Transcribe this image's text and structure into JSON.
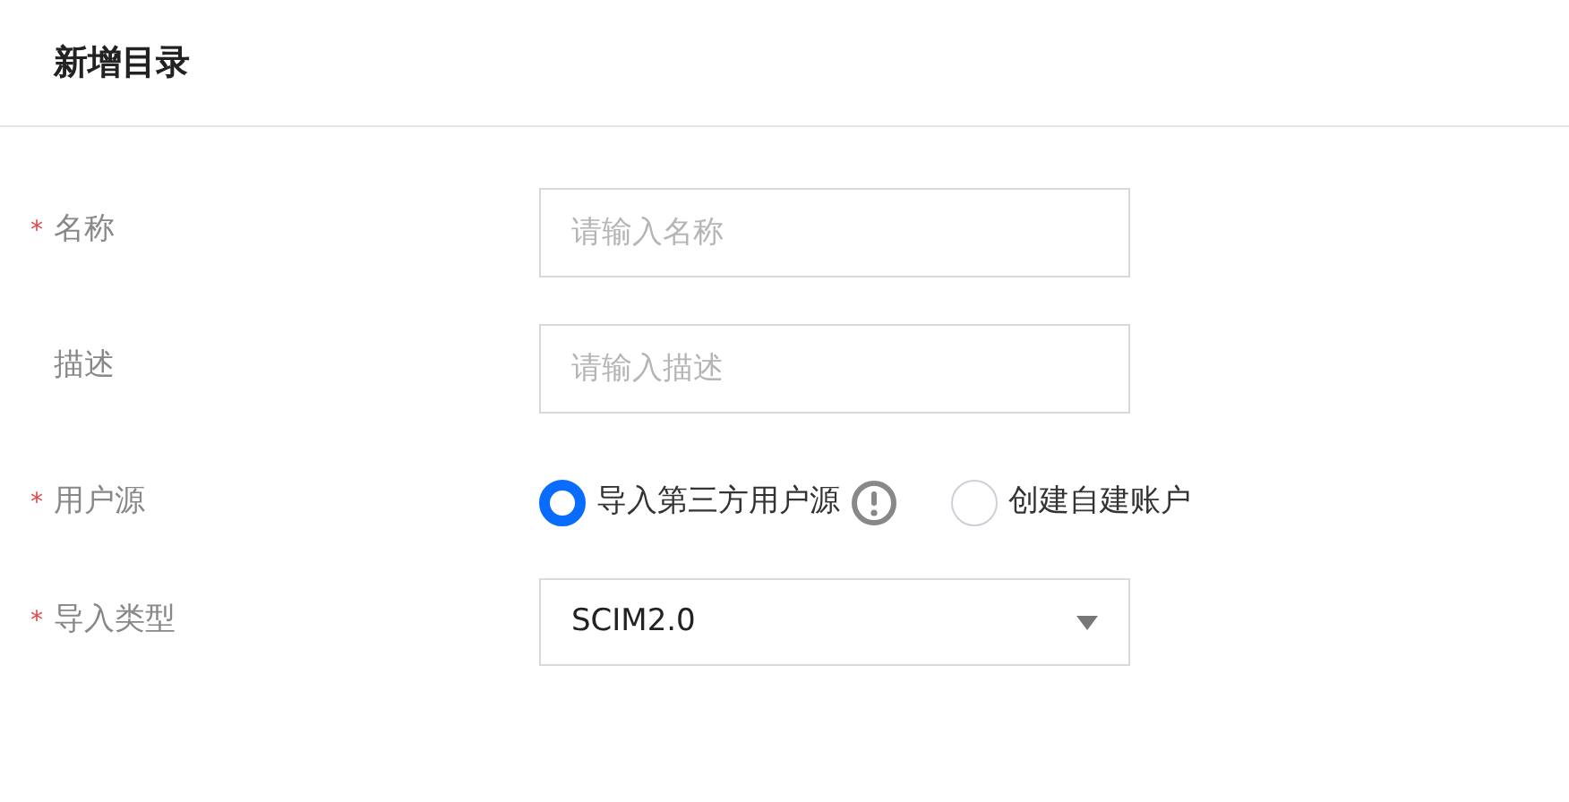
{
  "title": "新增目录",
  "fields": [
    {
      "kind": "input",
      "marker": "*",
      "label": "名称",
      "placeholder": "请输入名称"
    },
    {
      "kind": "input",
      "label": "描述",
      "placeholder": "请输入描述"
    },
    {
      "kind": "radio",
      "marker": "*",
      "label": "用户源",
      "options": [
        {
          "label": "导入第三方用户源",
          "selected": true,
          "kind": "hinted"
        },
        {
          "label": "创建自建账户",
          "selected": false,
          "kind": "plain"
        }
      ]
    },
    {
      "kind": "select",
      "marker": "*",
      "label": "导入类型",
      "value": "SCIM2.0"
    }
  ]
}
